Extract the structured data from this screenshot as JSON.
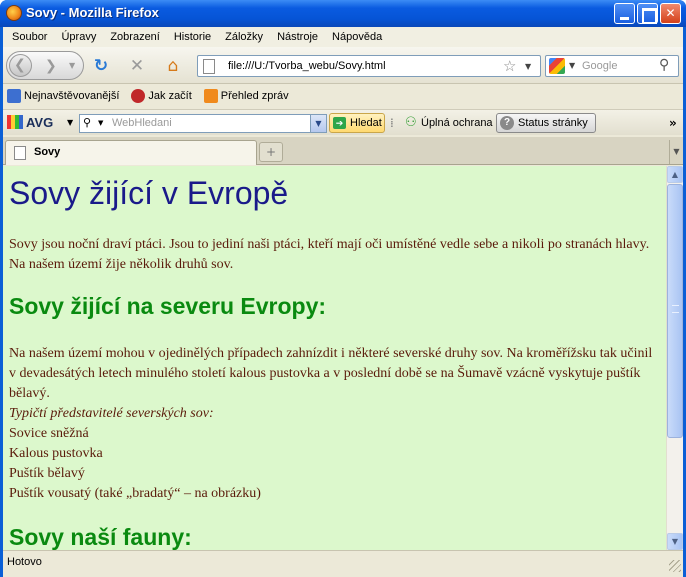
{
  "window": {
    "title": "Sovy - Mozilla Firefox"
  },
  "menubar": {
    "items": [
      "Soubor",
      "Úpravy",
      "Zobrazení",
      "Historie",
      "Záložky",
      "Nástroje",
      "Nápověda"
    ]
  },
  "navbar": {
    "url": "file:///U:/Tvorba_webu/Sovy.html",
    "search_placeholder": "Google"
  },
  "bookmarks": {
    "items": [
      "Nejnavštěvovanější",
      "Jak začít",
      "Přehled zpráv"
    ]
  },
  "avg": {
    "logo": "AVG",
    "search_placeholder": "WebHledani",
    "search_button": "Hledat",
    "protection_label": "Úplná ochrana",
    "status_button": "Status stránky",
    "overflow": "»"
  },
  "tabs": {
    "active_label": "Sovy",
    "new_tab": "+"
  },
  "page": {
    "heading": "Sovy žijící v Evropě",
    "intro": "Sovy jsou noční draví ptáci. Jsou to jediní naši ptáci, kteří mají oči umístěné vedle sebe a nikoli po stranách hlavy. Na našem území žije několik druhů sov.",
    "section1_heading": "Sovy žijící na severu Evropy:",
    "section1_text": "Na našem území mohou v ojedinělých případech zahnízdit i některé severské druhy sov. Na kroměřížsku tak učinil v devadesátých letech minulého století kalous pustovka a v poslední době se na Šumavě vzácně vyskytuje puštík bělavý.",
    "section1_subtitle": "Typičtí představitelé severských sov:",
    "owls": [
      "Sovice sněžná",
      "Kalous pustovka",
      "Puštík bělavý",
      "Puštík vousatý (také „bradatý“ – na obrázku)"
    ],
    "section2_heading": "Sovy naší fauny:"
  },
  "statusbar": {
    "text": "Hotovo"
  },
  "colors": {
    "page_background": "#dcf8cc",
    "heading_blue": "#1a1a8a",
    "heading_green": "#0a8a10",
    "body_text": "#5a1a0a"
  }
}
